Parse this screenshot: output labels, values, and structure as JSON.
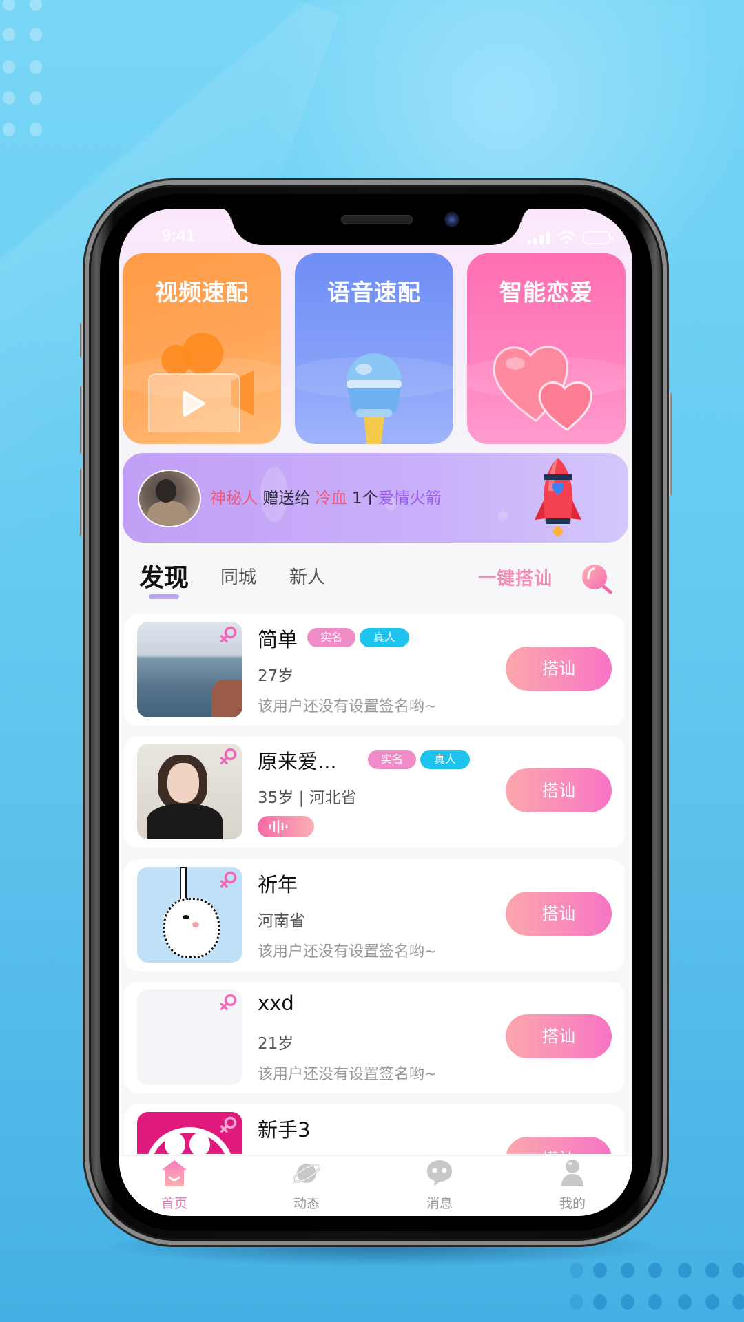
{
  "status_bar": {
    "time": "9:41"
  },
  "features": [
    {
      "label": "视频速配",
      "icon": "video-camera-icon"
    },
    {
      "label": "语音速配",
      "icon": "microphone-icon"
    },
    {
      "label": "智能恋爱",
      "icon": "hearts-icon"
    }
  ],
  "banner": {
    "sender": "神秘人",
    "verb": "赠送给",
    "recipient": "冷血",
    "quantity": "1个",
    "gift": "爱情火箭",
    "gift_icon": "rocket-icon"
  },
  "tabs": {
    "items": [
      {
        "label": "发现",
        "active": true
      },
      {
        "label": "同城",
        "active": false
      },
      {
        "label": "新人",
        "active": false
      }
    ],
    "quick_chat_label": "一键搭讪",
    "search_icon": "search-icon"
  },
  "users": [
    {
      "name": "简单",
      "badges": [
        "实名",
        "真人"
      ],
      "meta": "27岁",
      "signature": "该用户还没有设置签名哟~",
      "gender": "female",
      "button": "搭讪",
      "has_voice": false
    },
    {
      "name": "原来爱...",
      "badges": [
        "实名",
        "真人"
      ],
      "meta": "35岁 | 河北省",
      "signature": "",
      "gender": "female",
      "button": "搭讪",
      "has_voice": true
    },
    {
      "name": "祈年",
      "badges": [],
      "meta": "河南省",
      "signature": "该用户还没有设置签名哟~",
      "gender": "female",
      "button": "搭讪",
      "has_voice": false
    },
    {
      "name": "xxd",
      "badges": [],
      "meta": "21岁",
      "signature": "该用户还没有设置签名哟~",
      "gender": "female",
      "button": "搭讪",
      "has_voice": false
    },
    {
      "name": "新手3",
      "badges": [],
      "meta": "",
      "signature": "",
      "gender": "female",
      "button": "搭讪",
      "has_voice": false
    }
  ],
  "bottom_nav": [
    {
      "label": "首页",
      "icon": "home-icon",
      "active": true
    },
    {
      "label": "动态",
      "icon": "planet-icon",
      "active": false
    },
    {
      "label": "消息",
      "icon": "chat-bubble-icon",
      "active": false
    },
    {
      "label": "我的",
      "icon": "person-icon",
      "active": false
    }
  ],
  "colors": {
    "accent_pink": "#f773c4",
    "badge_real_name": "#f08cc8",
    "badge_real_person": "#1ec4ee",
    "tab_underline": "#b9a5f2",
    "nav_active": "#e47ab8"
  }
}
